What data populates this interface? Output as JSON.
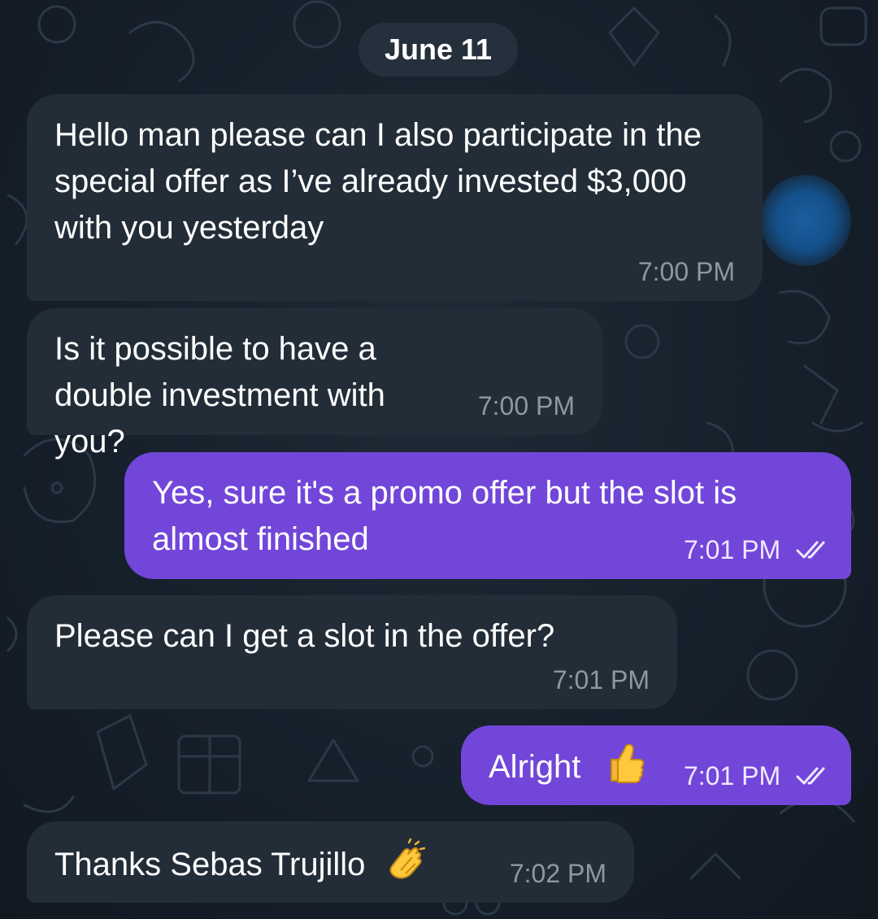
{
  "chat": {
    "date_separator": "June 11",
    "messages": [
      {
        "direction": "incoming",
        "text": "Hello man please can I also participate in the special offer as I’ve already invested $3,000 with you yesterday",
        "time": "7:00 PM"
      },
      {
        "direction": "incoming",
        "text": "Is it possible to have a double investment with you?",
        "time": "7:00 PM"
      },
      {
        "direction": "outgoing",
        "text": "Yes, sure it's a promo offer but the slot is almost finished",
        "time": "7:01 PM",
        "status_icon": "double-check-icon"
      },
      {
        "direction": "incoming",
        "text": "Please can I get a slot in the offer?",
        "time": "7:01 PM"
      },
      {
        "direction": "outgoing",
        "text": "Alright",
        "emoji": "thumbs-up-icon",
        "time": "7:01 PM",
        "status_icon": "double-check-icon"
      },
      {
        "direction": "incoming",
        "text": "Thanks Sebas Trujillo",
        "emoji": "clapping-hands-icon",
        "time": "7:02 PM"
      }
    ]
  },
  "colors": {
    "background": "#18222d",
    "incoming_bubble": "#222d38",
    "outgoing_bubble": "#7246d9",
    "incoming_time": "#8d98a3",
    "text": "#ffffff",
    "scroll_button": "#1a5ea0"
  }
}
